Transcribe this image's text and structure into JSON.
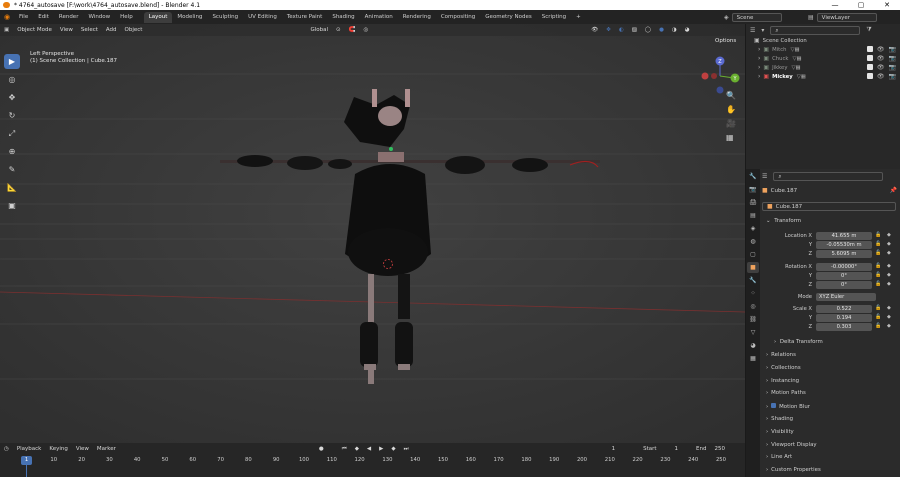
{
  "window": {
    "title": "* 4764_autosave [F:\\work\\4764_autosave.blend] - Blender 4.1",
    "controls": [
      "—",
      "▢",
      "✕"
    ]
  },
  "menu": [
    "File",
    "Edit",
    "Render",
    "Window",
    "Help"
  ],
  "workspaces": [
    "Layout",
    "Modeling",
    "Sculpting",
    "UV Editing",
    "Texture Paint",
    "Shading",
    "Animation",
    "Rendering",
    "Compositing",
    "Geometry Nodes",
    "Scripting"
  ],
  "active_workspace": "Layout",
  "scene": {
    "label": "Scene",
    "view_layer": "ViewLayer"
  },
  "viewport": {
    "mode": "Object Mode",
    "menus": [
      "View",
      "Select",
      "Add",
      "Object"
    ],
    "orientation": "Global",
    "options_label": "Options",
    "overlay_title": "Left Perspective",
    "overlay_subtitle": "(1) Scene Collection | Cube.187",
    "gizmo": {
      "z": "Z",
      "y": "Y"
    }
  },
  "tools": [
    "cursor",
    "move",
    "rotate",
    "scale",
    "transform",
    "annotate",
    "measure",
    "add-cube"
  ],
  "timeline": {
    "menus": [
      "Playback",
      "Keying",
      "View",
      "Marker"
    ],
    "current_frame": "1",
    "start_label": "Start",
    "start": "1",
    "end_label": "End",
    "end": "250",
    "ticks": [
      "0",
      "10",
      "20",
      "30",
      "40",
      "50",
      "60",
      "70",
      "80",
      "90",
      "100",
      "110",
      "120",
      "130",
      "140",
      "150",
      "160",
      "170",
      "180",
      "190",
      "200",
      "210",
      "220",
      "230",
      "240",
      "250"
    ],
    "playhead_label": "1"
  },
  "outliner": {
    "root": "Scene Collection",
    "items": [
      {
        "name": "Mitch",
        "selected": false
      },
      {
        "name": "Chuck",
        "selected": false
      },
      {
        "name": "Jikkey",
        "selected": false
      },
      {
        "name": "Mickey",
        "selected": true
      }
    ]
  },
  "properties": {
    "object_name": "Cube.187",
    "data_name": "Cube.187",
    "transform_label": "Transform",
    "location": {
      "label": "Location X",
      "x": "41.655 m",
      "y": "-0.05530m m",
      "z": "5.6095 m"
    },
    "rotation": {
      "label": "Rotation X",
      "x": "-0.00000°",
      "y": "0°",
      "z": "0°"
    },
    "mode": {
      "label": "Mode",
      "value": "XYZ Euler"
    },
    "scale": {
      "label": "Scale X",
      "x": "0.522",
      "y": "0.194",
      "z": "0.303"
    },
    "axis_y": "Y",
    "axis_z": "Z",
    "delta_transform": "Delta Transform",
    "panels": [
      "Relations",
      "Collections",
      "Instancing",
      "Motion Paths",
      "Motion Blur",
      "Shading",
      "Visibility",
      "Viewport Display",
      "Line Art",
      "Custom Properties"
    ]
  }
}
